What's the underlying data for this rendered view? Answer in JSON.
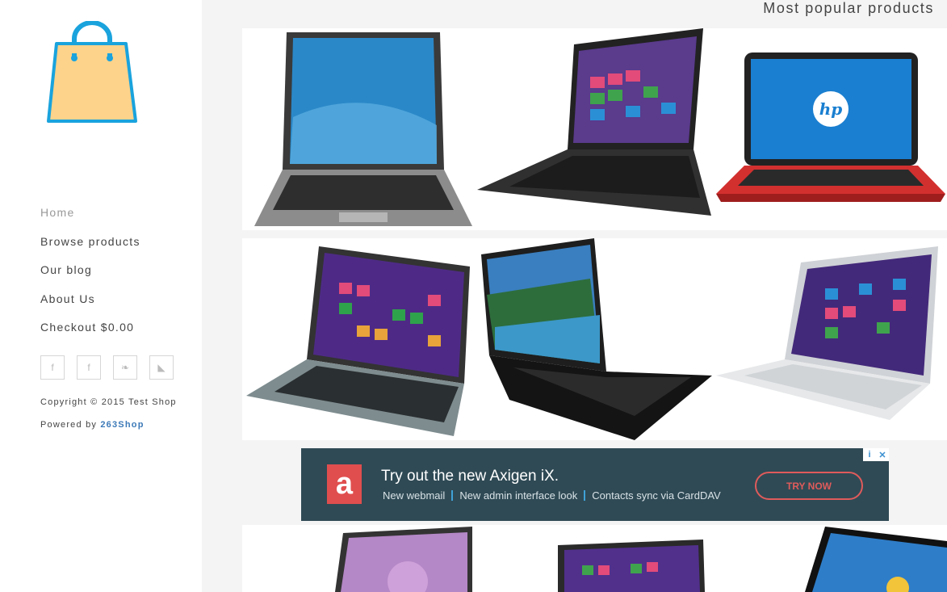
{
  "nav": {
    "items": [
      {
        "label": "Home"
      },
      {
        "label": "Browse products"
      },
      {
        "label": "Our blog"
      },
      {
        "label": "About Us"
      },
      {
        "label": "Checkout $0.00"
      }
    ]
  },
  "social": [
    {
      "glyph": "f",
      "icon": "facebook-icon"
    },
    {
      "glyph": "f",
      "icon": "facebook-icon"
    },
    {
      "glyph": "❧",
      "icon": "twitter-icon"
    },
    {
      "glyph": "◣",
      "icon": "rss-icon"
    }
  ],
  "footer": {
    "copyright": "Copyright © 2015 Test Shop",
    "powered_prefix": "Powered by ",
    "powered_link": "263Shop"
  },
  "main": {
    "title": "Most popular products"
  },
  "ad": {
    "logo_letter": "a",
    "title": "Try out the new Axigen iX.",
    "features": [
      "New webmail",
      "New admin interface look",
      "Contacts sync via CardDAV"
    ],
    "cta": "TRY NOW",
    "info_icon": "i",
    "close_icon": "✕"
  },
  "colors": {
    "accent_link": "#3d7ab8",
    "ad_bg": "#2f4a55",
    "ad_brand": "#e04e4e",
    "bag_fill": "#fdd38b",
    "bag_stroke": "#1aa3dd"
  }
}
